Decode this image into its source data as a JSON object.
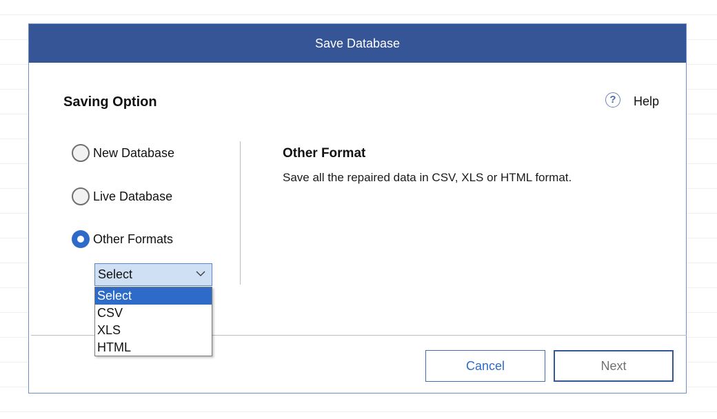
{
  "dialog": {
    "title": "Save Database"
  },
  "saving_option": {
    "heading": "Saving Option",
    "help_label": "Help",
    "help_icon": "?",
    "options": [
      {
        "label": "New Database",
        "checked": false
      },
      {
        "label": "Live Database",
        "checked": false
      },
      {
        "label": "Other Formats",
        "checked": true
      }
    ]
  },
  "format_select": {
    "value": "Select",
    "options": [
      "Select",
      "CSV",
      "XLS",
      "HTML"
    ],
    "selected_index": 0
  },
  "description": {
    "title": "Other Format",
    "text": "Save all the repaired data in CSV, XLS or HTML format."
  },
  "buttons": {
    "cancel": "Cancel",
    "next": "Next"
  },
  "colors": {
    "titlebar": "#365597",
    "accent": "#2e6ac8",
    "select_bg": "#cfe0f5"
  }
}
